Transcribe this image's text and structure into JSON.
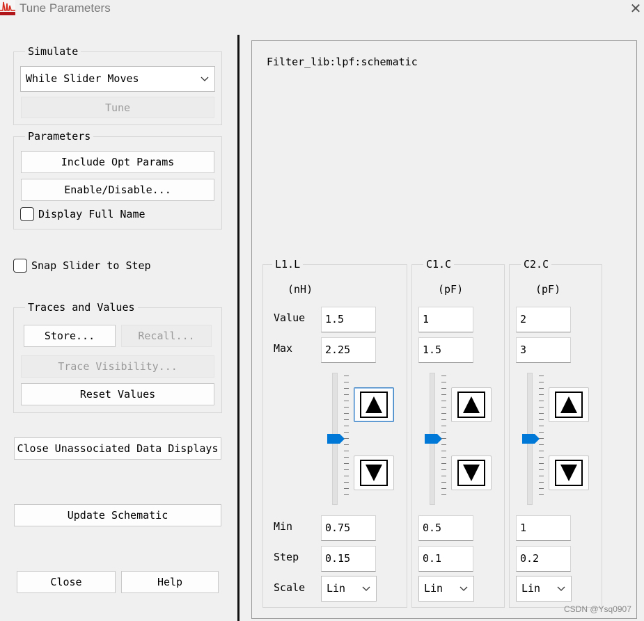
{
  "window": {
    "title": "Tune Parameters",
    "close_glyph": "✕"
  },
  "simulate": {
    "group_label": "Simulate",
    "mode_value": "While Slider Moves",
    "tune_label": "Tune"
  },
  "parameters": {
    "group_label": "Parameters",
    "include_opt_label": "Include Opt Params",
    "enable_disable_label": "Enable/Disable...",
    "display_full_name_label": "Display Full Name",
    "display_full_name_checked": false
  },
  "snap_slider": {
    "label": "Snap Slider to Step",
    "checked": false
  },
  "traces": {
    "group_label": "Traces and Values",
    "store_label": "Store...",
    "recall_label": "Recall...",
    "trace_visibility_label": "Trace Visibility...",
    "reset_values_label": "Reset Values"
  },
  "close_unassociated_label": "Close Unassociated Data Displays",
  "update_schematic_label": "Update Schematic",
  "close_label": "Close",
  "help_label": "Help",
  "schematic_name": "Filter_lib:lpf:schematic",
  "row_labels": {
    "value": "Value",
    "max": "Max",
    "min": "Min",
    "step": "Step",
    "scale": "Scale"
  },
  "tuners": [
    {
      "name": "L1.L",
      "unit": "(nH)",
      "value": "1.5",
      "max": "2.25",
      "min": "0.75",
      "step": "0.15",
      "scale": "Lin",
      "slider_fraction": 0.5
    },
    {
      "name": "C1.C",
      "unit": "(pF)",
      "value": "1",
      "max": "1.5",
      "min": "0.5",
      "step": "0.1",
      "scale": "Lin",
      "slider_fraction": 0.5
    },
    {
      "name": "C2.C",
      "unit": "(pF)",
      "value": "2",
      "max": "3",
      "min": "1",
      "step": "0.2",
      "scale": "Lin",
      "slider_fraction": 0.5
    }
  ],
  "watermark": "CSDN @Ysq0907",
  "colors": {
    "slider_thumb": "#0078d7",
    "app_icon_bg": "#b0151a",
    "focus_border": "#3b82c4"
  },
  "icons": [
    "app-logo-icon",
    "close-icon",
    "chevron-down-icon",
    "arrow-up-icon",
    "arrow-down-icon"
  ]
}
